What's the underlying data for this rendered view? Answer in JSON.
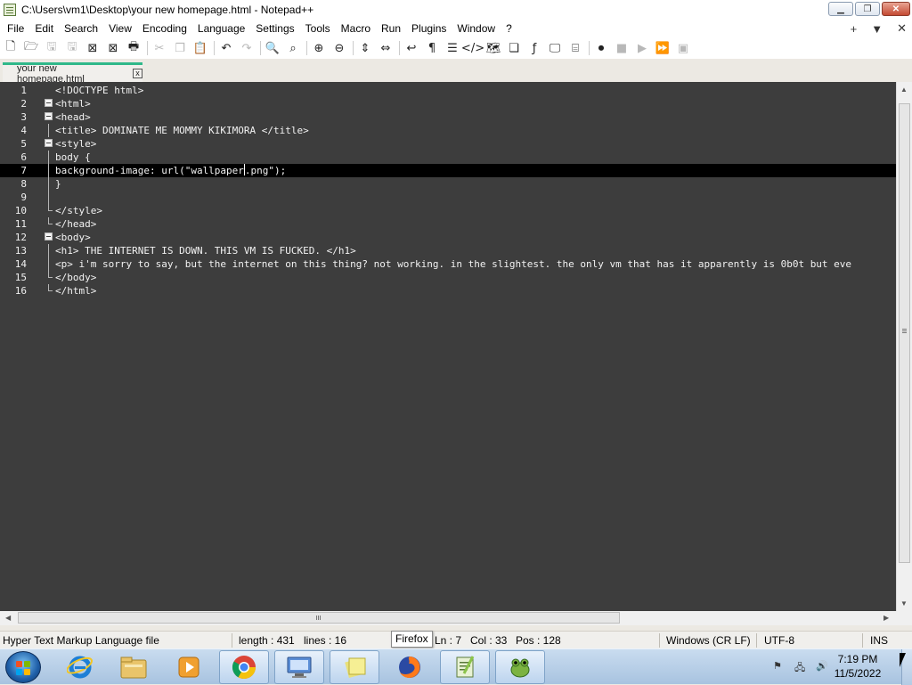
{
  "window": {
    "title": "C:\\Users\\vm1\\Desktop\\your new homepage.html - Notepad++",
    "min_label": "▁",
    "max_label": "❐",
    "close_label": "✕"
  },
  "menu": {
    "items": [
      "File",
      "Edit",
      "Search",
      "View",
      "Encoding",
      "Language",
      "Settings",
      "Tools",
      "Macro",
      "Run",
      "Plugins",
      "Window",
      "?"
    ],
    "right": [
      "+",
      "▼",
      "✕"
    ]
  },
  "toolbar": {
    "icons": [
      "new-file-icon",
      "open-file-icon",
      "save-icon",
      "save-all-icon",
      "close-icon",
      "close-all-icon",
      "print-icon",
      "cut-icon",
      "copy-icon",
      "paste-icon",
      "undo-icon",
      "redo-icon",
      "find-icon",
      "replace-icon",
      "zoom-in-icon",
      "zoom-out-icon",
      "sync-vertical-icon",
      "sync-horizontal-icon",
      "word-wrap-icon",
      "show-all-chars-icon",
      "indent-guide-icon",
      "xml-tag-icon",
      "document-map-icon",
      "function-list-icon",
      "function-icon",
      "monitor-icon",
      "folder-workspace-icon",
      "record-macro-icon",
      "stop-record-icon",
      "play-macro-icon",
      "run-macro-multiple-icon",
      "save-macro-icon"
    ]
  },
  "tab": {
    "label": "your new homepage.html",
    "close_label": "x"
  },
  "editor": {
    "current_line": 7,
    "lines": [
      {
        "n": "1",
        "text": "<!DOCTYPE html>",
        "fold": "none"
      },
      {
        "n": "2",
        "text": "<html>",
        "fold": "open"
      },
      {
        "n": "3",
        "text": "<head>",
        "fold": "open"
      },
      {
        "n": "4",
        "text": "<title> DOMINATE ME MOMMY KIKIMORA </title>",
        "fold": "line"
      },
      {
        "n": "5",
        "text": "<style>",
        "fold": "open"
      },
      {
        "n": "6",
        "text": "body {",
        "fold": "line"
      },
      {
        "n": "7",
        "text": "background-image: url(\"wallpaper.png\");",
        "fold": "line"
      },
      {
        "n": "8",
        "text": "}",
        "fold": "line"
      },
      {
        "n": "9",
        "text": "",
        "fold": "line"
      },
      {
        "n": "10",
        "text": "</style>",
        "fold": "end"
      },
      {
        "n": "11",
        "text": "</head>",
        "fold": "end"
      },
      {
        "n": "12",
        "text": "<body>",
        "fold": "open"
      },
      {
        "n": "13",
        "text": "<h1> THE INTERNET IS DOWN. THIS VM IS FUCKED. </h1>",
        "fold": "line"
      },
      {
        "n": "14",
        "text": "<p> i'm sorry to say, but the internet on this thing? not working. in the slightest. the only vm that has it apparently is 0b0t but eve",
        "fold": "line"
      },
      {
        "n": "15",
        "text": "</body>",
        "fold": "end"
      },
      {
        "n": "16",
        "text": "</html>",
        "fold": "end"
      }
    ]
  },
  "status": {
    "file_type": "Hyper Text Markup Language file",
    "length": "length : 431",
    "lines": "lines : 16",
    "ln": "Ln : 7",
    "col": "Col : 33",
    "pos": "Pos : 128",
    "eol": "Windows (CR LF)",
    "encoding": "UTF-8",
    "mode": "INS",
    "tooltip": "Firefox"
  },
  "taskbar": {
    "apps": [
      "internet-explorer-icon",
      "file-explorer-icon",
      "media-player-icon",
      "chrome-icon",
      "remote-desktop-icon",
      "sticky-notes-icon",
      "firefox-icon",
      "notepad-plus-plus-icon",
      "frog-app-icon"
    ],
    "time": "7:19 PM",
    "date": "11/5/2022"
  }
}
